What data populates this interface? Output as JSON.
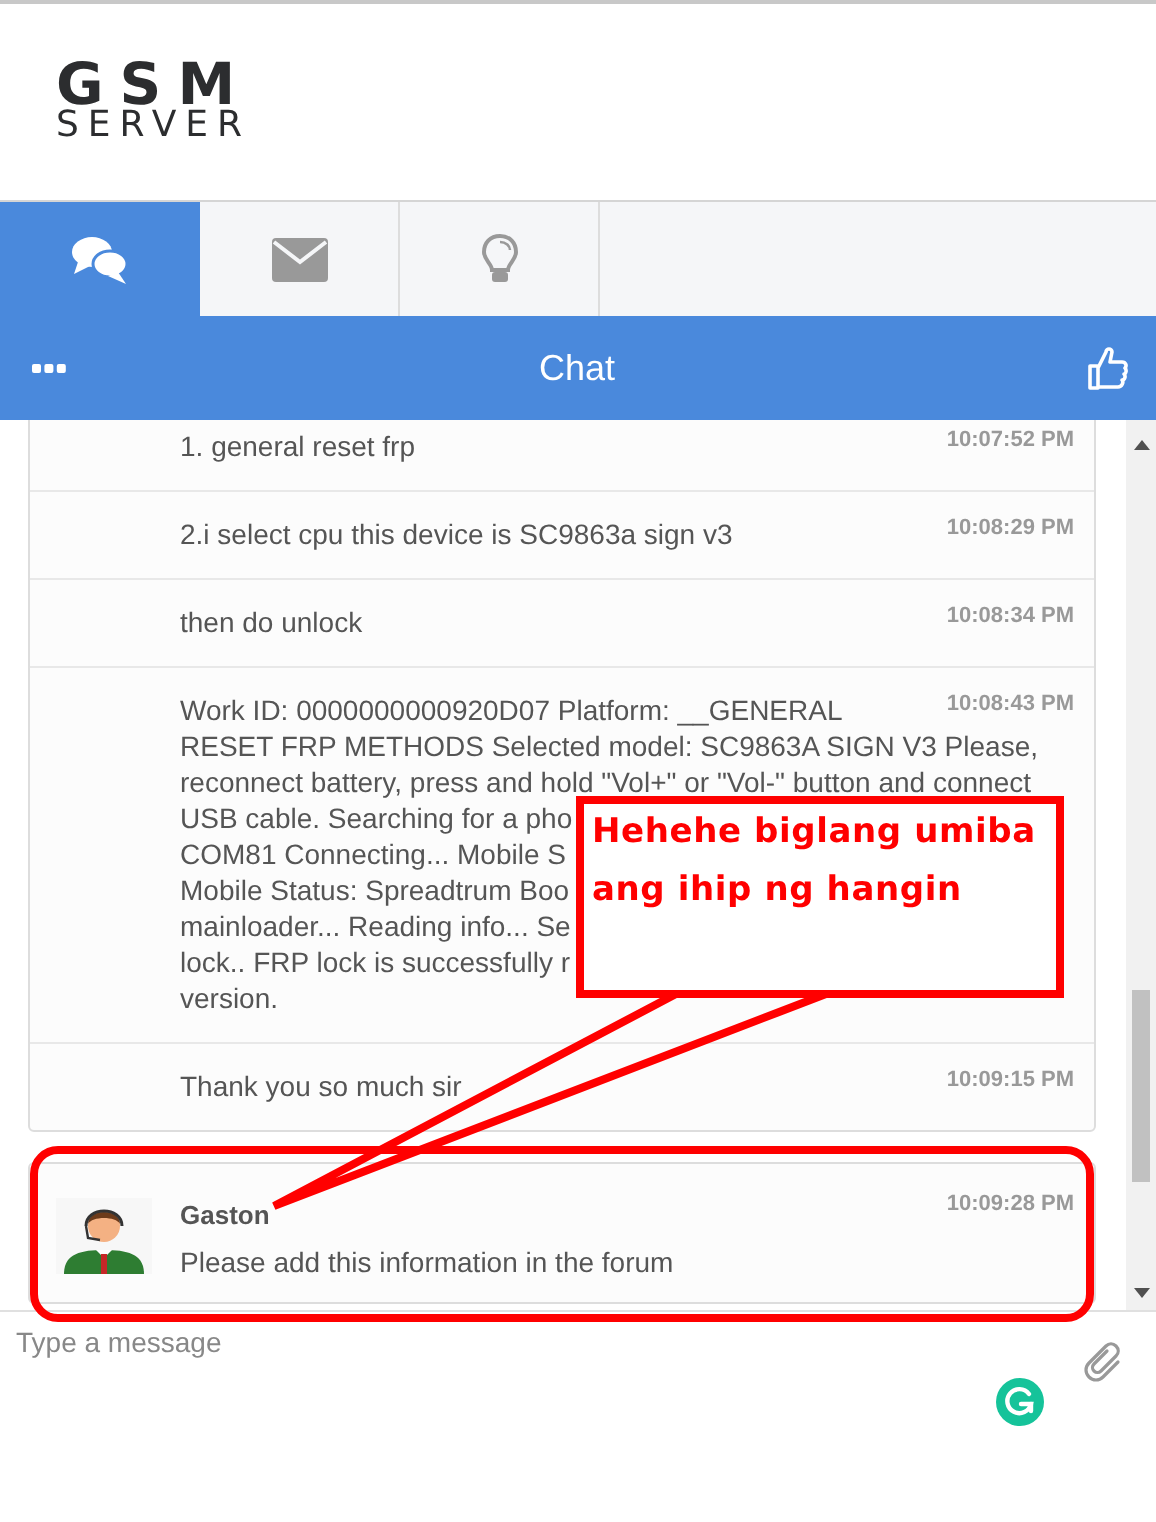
{
  "logo": {
    "line_1": "GSM",
    "line_2": "SERVER"
  },
  "tabs": [
    {
      "kind": "chat",
      "selected": true
    },
    {
      "kind": "mail",
      "selected": false
    },
    {
      "kind": "bulb",
      "selected": false
    }
  ],
  "chat_bar": {
    "title": "Chat"
  },
  "messages": [
    {
      "kind": "text",
      "text": "1. general reset frp",
      "time": "10:07:52 PM"
    },
    {
      "kind": "text",
      "text": "2.i select cpu this device is SC9863a sign v3",
      "time": "10:08:29 PM"
    },
    {
      "kind": "text",
      "text": "then do unlock",
      "time": "10:08:34 PM"
    },
    {
      "kind": "lines",
      "lines": [
        "Work ID: 0000000000920D07 Platform: __GENERAL",
        "RESET FRP METHODS Selected model: SC9863A SIGN V3 Please,",
        "reconnect battery, press and hold \"Vol+\" or \"Vol-\" button and connect",
        "USB cable. Searching for a pho",
        "COM81 Connecting... Mobile S",
        "Mobile Status: Spreadtrum Boo",
        "mainloader... Reading info... Se",
        "lock.. FRP lock is successfully r",
        "version."
      ],
      "time": "10:08:43 PM"
    },
    {
      "kind": "text",
      "text": "Thank you so much sir",
      "time": "10:09:15 PM"
    }
  ],
  "agent_message": {
    "name": "Gaston",
    "text": "Please add this information in the forum",
    "time": "10:09:28 PM"
  },
  "input": {
    "placeholder": "Type a message"
  },
  "annotation": {
    "lines": [
      "Hehehe biglang umiba",
      "ang ihip ng hangin"
    ]
  }
}
